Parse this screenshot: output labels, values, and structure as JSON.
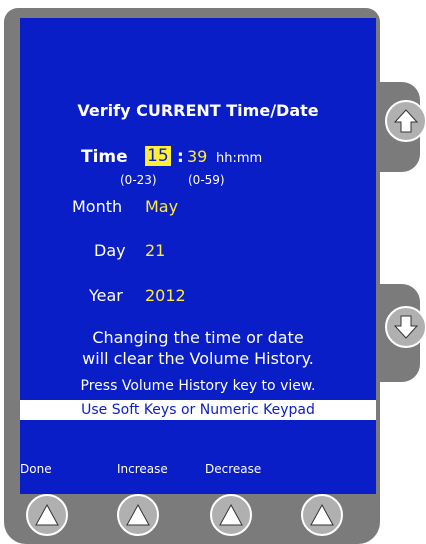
{
  "screen": {
    "title": "Verify CURRENT Time/Date",
    "time": {
      "label": "Time",
      "hours": "15",
      "colon": ":",
      "minutes": "39",
      "format": "hh:mm",
      "hours_range": "(0-23)",
      "minutes_range": "(0-59)"
    },
    "month": {
      "label": "Month",
      "value": "May"
    },
    "day": {
      "label": "Day",
      "value": "21"
    },
    "year": {
      "label": "Year",
      "value": "2012"
    },
    "message_line1": "Changing the time or date",
    "message_line2": "will clear the Volume History.",
    "message_line3": "Press Volume History key to view.",
    "hint_bar": "Use Soft Keys or Numeric Keypad"
  },
  "softkeys": {
    "labels": [
      "Done",
      "Increase",
      "Decrease"
    ],
    "count": 4
  },
  "side_keys": [
    "up-arrow-icon",
    "down-arrow-icon"
  ],
  "colors": {
    "screen_bg": "#0a1ec8",
    "highlight": "#ffef3a",
    "value_text": "#ffeb3b",
    "bezel": "#7b7b7b"
  }
}
